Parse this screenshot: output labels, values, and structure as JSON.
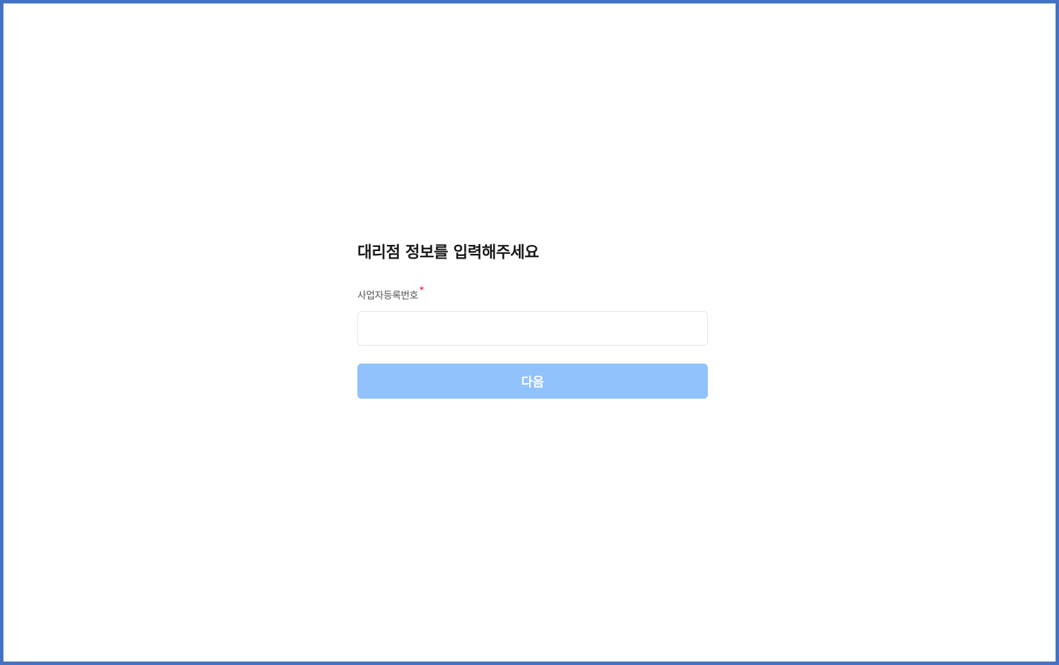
{
  "form": {
    "title": "대리점 정보를 입력해주세요",
    "business_number": {
      "label": "사업자등록번호",
      "required_mark": "*",
      "value": "",
      "placeholder": ""
    },
    "next_button": {
      "label": "다음",
      "enabled": false
    }
  },
  "colors": {
    "frame_border": "#4472c4",
    "button_background": "#91c2fc",
    "required_mark": "#f0314a"
  }
}
